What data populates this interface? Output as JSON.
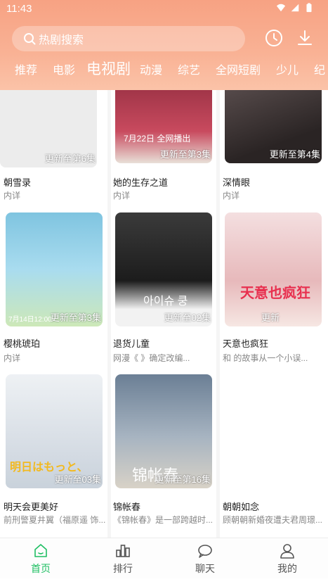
{
  "status_bar": {
    "time": "11:43"
  },
  "search": {
    "placeholder": "热剧搜索"
  },
  "category_tabs": [
    {
      "label": "推荐"
    },
    {
      "label": "电影"
    },
    {
      "label": "电视剧",
      "active": true
    },
    {
      "label": "动漫"
    },
    {
      "label": "综艺"
    },
    {
      "label": "全网短剧"
    },
    {
      "label": "少儿"
    },
    {
      "label": "纪"
    }
  ],
  "cards": [
    {
      "title": "朝雪录",
      "desc": "内详",
      "badge": "更新至第6集",
      "poster_color": "#ececec"
    },
    {
      "title": "她的生存之道",
      "desc": "内详",
      "badge": "更新至第3集",
      "poster_color": "#b23a4e"
    },
    {
      "title": "深情眼",
      "desc": "内详",
      "badge": "更新至第4集",
      "poster_color": "#3a3434"
    },
    {
      "title": "樱桃琥珀",
      "desc": "内详",
      "badge": "更新至第3集",
      "poster_color": "#6fb6d6"
    },
    {
      "title": "退货儿童",
      "desc": "网漫《 》确定改编...",
      "badge": "更新至02集",
      "poster_color": "#2b2b2b"
    },
    {
      "title": "天意也疯狂",
      "desc": "和 的故事从一个小误...",
      "badge": "更新",
      "poster_color": "#e9c7c3"
    },
    {
      "title": "明天会更美好",
      "desc": "前刑警夏井翼（福原遥 饰...",
      "badge": "更新至03集",
      "poster_color": "#dfe4ea"
    },
    {
      "title": "锦帐春",
      "desc": "《锦帐春》是一部跨越时...",
      "badge": "更新至第16集",
      "poster_color": "#8c9cae"
    },
    {
      "title": "朝朝如念",
      "desc": "顾朝朝新婚夜遭夫君周璟...",
      "badge": "",
      "poster_color": "#ffffff"
    }
  ],
  "poster_captions": {
    "card2_top": "7月22日 全网播出",
    "card4_bottom": "7月14日12:00",
    "card5_text": "아이슈 쿵",
    "card6_text": "天意也疯狂",
    "card7_text": "明日はもっと、",
    "card8_text": "锦帐春"
  },
  "bottom_nav": [
    {
      "label": "首页",
      "icon": "home-icon",
      "active": true
    },
    {
      "label": "排行",
      "icon": "ranking-icon"
    },
    {
      "label": "聊天",
      "icon": "chat-icon"
    },
    {
      "label": "我的",
      "icon": "profile-icon"
    }
  ],
  "colors": {
    "accent": "#1fbf63",
    "header": "#f7a283"
  }
}
